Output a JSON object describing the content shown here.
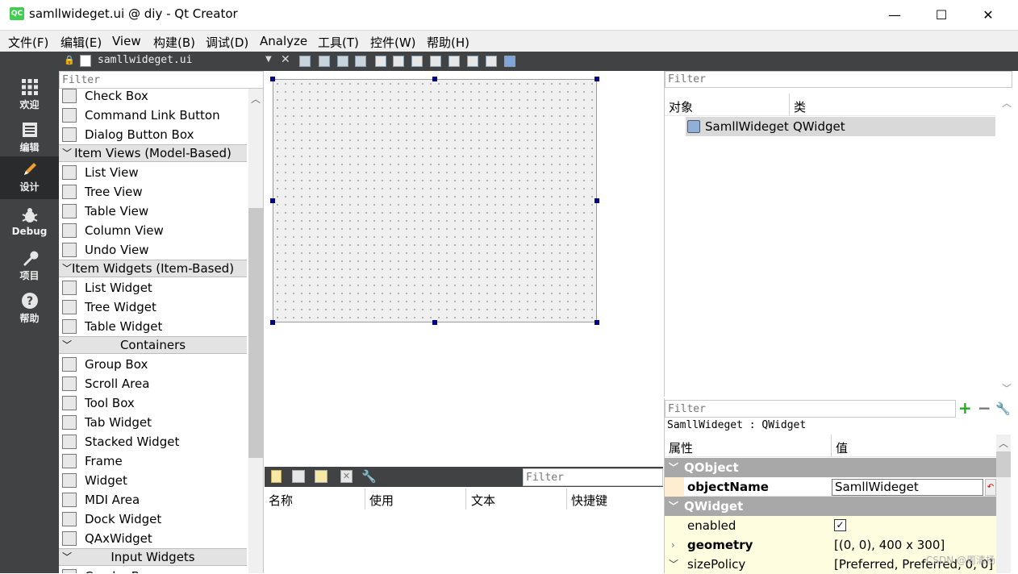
{
  "window": {
    "title": "samllwideget.ui @ diy - Qt Creator",
    "logo": "QC"
  },
  "menu": [
    "文件(F)",
    "编辑(E)",
    "View",
    "构建(B)",
    "调试(D)",
    "Analyze",
    "工具(T)",
    "控件(W)",
    "帮助(H)"
  ],
  "modes": [
    {
      "label": "欢迎",
      "icon": "grid-icon"
    },
    {
      "label": "编辑",
      "icon": "document-icon"
    },
    {
      "label": "设计",
      "icon": "pencil-icon"
    },
    {
      "label": "Debug",
      "icon": "bug-icon"
    },
    {
      "label": "项目",
      "icon": "wrench-icon"
    },
    {
      "label": "帮助",
      "icon": "help-icon"
    }
  ],
  "toolbar": {
    "document": "samllwideget.ui"
  },
  "widget_box": {
    "filter_placeholder": "Filter",
    "items": [
      {
        "type": "item",
        "label": "Check Box"
      },
      {
        "type": "item",
        "label": "Command Link Button"
      },
      {
        "type": "item",
        "label": "Dialog Button Box"
      },
      {
        "type": "category",
        "label": "Item Views (Model-Based)"
      },
      {
        "type": "item",
        "label": "List View"
      },
      {
        "type": "item",
        "label": "Tree View"
      },
      {
        "type": "item",
        "label": "Table View"
      },
      {
        "type": "item",
        "label": "Column View"
      },
      {
        "type": "item",
        "label": "Undo View"
      },
      {
        "type": "category",
        "label": "Item Widgets (Item-Based)"
      },
      {
        "type": "item",
        "label": "List Widget"
      },
      {
        "type": "item",
        "label": "Tree Widget"
      },
      {
        "type": "item",
        "label": "Table Widget"
      },
      {
        "type": "category",
        "label": "Containers"
      },
      {
        "type": "item",
        "label": "Group Box"
      },
      {
        "type": "item",
        "label": "Scroll Area"
      },
      {
        "type": "item",
        "label": "Tool Box"
      },
      {
        "type": "item",
        "label": "Tab Widget"
      },
      {
        "type": "item",
        "label": "Stacked Widget"
      },
      {
        "type": "item",
        "label": "Frame"
      },
      {
        "type": "item",
        "label": "Widget"
      },
      {
        "type": "item",
        "label": "MDI Area"
      },
      {
        "type": "item",
        "label": "Dock Widget"
      },
      {
        "type": "item",
        "label": "QAxWidget"
      },
      {
        "type": "category",
        "label": "Input Widgets"
      },
      {
        "type": "item",
        "label": "Combo Box"
      }
    ]
  },
  "action_editor": {
    "filter_placeholder": "Filter",
    "columns": [
      "名称",
      "使用",
      "文本",
      "快捷键"
    ]
  },
  "object_inspector": {
    "filter_placeholder": "Filter",
    "columns": [
      "对象",
      "类"
    ],
    "rows": [
      {
        "object": "SamllWideget",
        "class": "QWidget"
      }
    ]
  },
  "property_editor": {
    "filter_placeholder": "Filter",
    "context": "SamllWideget : QWidget",
    "columns": [
      "属性",
      "值"
    ],
    "groups": [
      {
        "name": "QObject",
        "rows": [
          {
            "name": "objectName",
            "value": "SamllWideget"
          }
        ]
      },
      {
        "name": "QWidget",
        "rows": [
          {
            "name": "enabled",
            "value": "✓"
          },
          {
            "name": "geometry",
            "value": "[(0, 0), 400 x 300]"
          },
          {
            "name": "sizePolicy",
            "value": "[Preferred, Preferred, 0, 0]"
          }
        ]
      }
    ]
  },
  "watermark": "CSDN @周清扬"
}
